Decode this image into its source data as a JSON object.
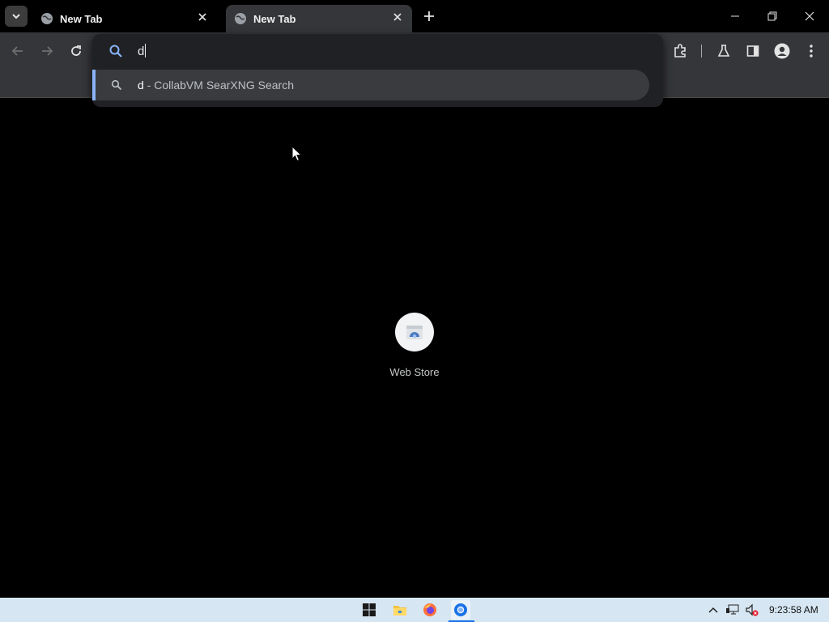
{
  "tabs": [
    {
      "title": "New Tab",
      "active": false
    },
    {
      "title": "New Tab",
      "active": true
    }
  ],
  "omnibox": {
    "value": "d",
    "suggestion_query": "d",
    "suggestion_suffix": " - CollabVM SearXNG Search"
  },
  "shortcuts": [
    {
      "label": "Web Store",
      "icon": "web-store-icon"
    }
  ],
  "taskbar": {
    "apps": [
      "start-icon",
      "file-explorer-icon",
      "firefox-icon",
      "chrome-icon"
    ],
    "clock": "9:23:58 AM"
  },
  "colors": {
    "accent": "#8ab4f8",
    "toolbar_bg": "#35363a",
    "omnibox_bg": "#202124",
    "suggestion_bg": "#3a3b3e",
    "taskbar_bg": "#d6e6f2"
  }
}
